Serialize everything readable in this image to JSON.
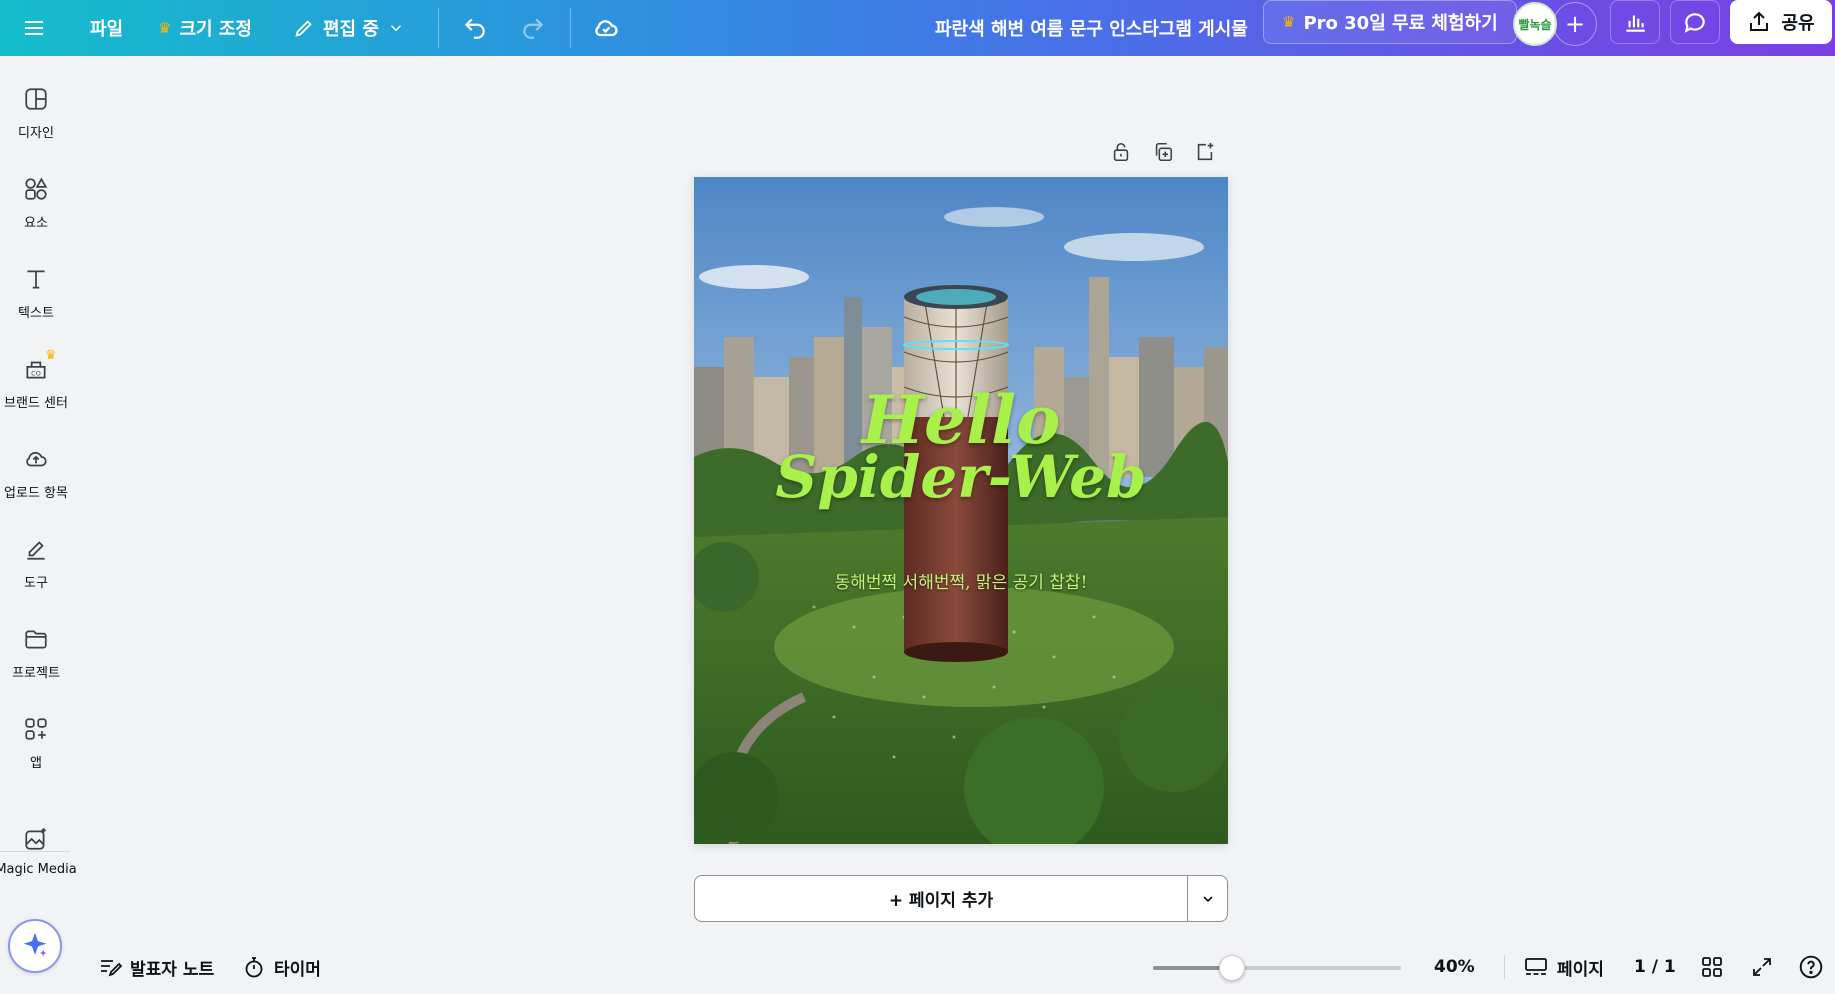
{
  "topbar": {
    "file_label": "파일",
    "resize_label": "크기 조정",
    "edit_mode_label": "편집 중",
    "document_title": "파란색 해변 여름 문구 인스타그램 게시물",
    "pro_trial_label": "Pro 30일 무료 체험하기",
    "avatar_text": "빨녹슬",
    "share_label": "공유"
  },
  "sidebar": {
    "items": [
      {
        "label": "디자인",
        "icon": "design-layout-icon"
      },
      {
        "label": "요소",
        "icon": "elements-shapes-icon"
      },
      {
        "label": "텍스트",
        "icon": "text-t-icon"
      },
      {
        "label": "브랜드 센터",
        "icon": "brand-kit-icon"
      },
      {
        "label": "업로드 항목",
        "icon": "cloud-upload-icon"
      },
      {
        "label": "도구",
        "icon": "pen-draw-icon"
      },
      {
        "label": "프로젝트",
        "icon": "folder-icon"
      },
      {
        "label": "앱",
        "icon": "apps-grid-icon"
      },
      {
        "label": "Magic Media",
        "icon": "magic-media-icon"
      }
    ]
  },
  "design": {
    "headline_line1": "Hello",
    "headline_line2": "Spider-Web",
    "subtitle": "동해번쩍 서해번쩍, 맑은 공기 찹찹!"
  },
  "canvas": {
    "add_page_label": "+ 페이지 추가"
  },
  "bottombar": {
    "notes_label": "발표자 노트",
    "timer_label": "타이머",
    "zoom_value": 0.4,
    "zoom_label": "40%",
    "pages_label": "페이지",
    "page_counter": "1 / 1"
  },
  "colors": {
    "accent_gradient_start": "#14bdcb",
    "accent_gradient_end": "#7a3fe4",
    "headline_green": "#a8f04a",
    "crown_gold": "#ffb400"
  }
}
